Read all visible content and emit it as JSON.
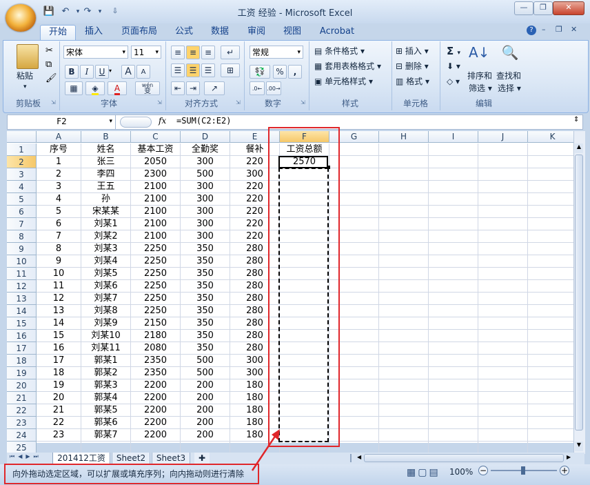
{
  "window": {
    "title": "工资 经验 - Microsoft Excel"
  },
  "ribbon_tabs": [
    "开始",
    "插入",
    "页面布局",
    "公式",
    "数据",
    "审阅",
    "视图",
    "Acrobat"
  ],
  "active_tab": "开始",
  "clipboard": {
    "paste": "粘贴",
    "group": "剪贴板"
  },
  "font": {
    "name": "宋体",
    "size": "11",
    "bold": "B",
    "italic": "I",
    "underline": "U",
    "grow": "A",
    "shrink": "A",
    "wen": "wén",
    "wen_char": "变",
    "group": "字体"
  },
  "alignment": {
    "group": "对齐方式"
  },
  "number": {
    "format": "常规",
    "percent": "%",
    "comma": ",",
    "group": "数字"
  },
  "styles": {
    "conditional": "条件格式",
    "table": "套用表格格式",
    "cell": "单元格样式",
    "group": "样式"
  },
  "cells": {
    "insert": "插入",
    "delete": "删除",
    "format": "格式",
    "group": "单元格"
  },
  "editing": {
    "sigma": "Σ",
    "sort": "排序和",
    "sort2": "筛选",
    "find": "查找和",
    "find2": "选择",
    "group": "编辑"
  },
  "formula_bar": {
    "name_box": "F2",
    "fx": "fx",
    "formula": "=SUM(C2:E2)"
  },
  "columns": [
    "A",
    "B",
    "C",
    "D",
    "E",
    "F",
    "G",
    "H",
    "I",
    "J",
    "K"
  ],
  "row_numbers": [
    "1",
    "2",
    "3",
    "4",
    "5",
    "6",
    "7",
    "8",
    "9",
    "10",
    "11",
    "12",
    "13",
    "14",
    "15",
    "16",
    "17",
    "18",
    "19",
    "20",
    "21",
    "22",
    "23",
    "24",
    "25"
  ],
  "header_row": [
    "序号",
    "姓名",
    "基本工资",
    "全勤奖",
    "餐补",
    "工资总额"
  ],
  "rows": [
    [
      "1",
      "张三",
      "2050",
      "300",
      "220",
      "2570"
    ],
    [
      "2",
      "李四",
      "2300",
      "500",
      "300",
      ""
    ],
    [
      "3",
      "王五",
      "2100",
      "300",
      "220",
      ""
    ],
    [
      "4",
      "孙",
      "2100",
      "300",
      "220",
      ""
    ],
    [
      "5",
      "宋某某",
      "2100",
      "300",
      "220",
      ""
    ],
    [
      "6",
      "刘某1",
      "2100",
      "300",
      "220",
      ""
    ],
    [
      "7",
      "刘某2",
      "2100",
      "300",
      "220",
      ""
    ],
    [
      "8",
      "刘某3",
      "2250",
      "350",
      "280",
      ""
    ],
    [
      "9",
      "刘某4",
      "2250",
      "350",
      "280",
      ""
    ],
    [
      "10",
      "刘某5",
      "2250",
      "350",
      "280",
      ""
    ],
    [
      "11",
      "刘某6",
      "2250",
      "350",
      "280",
      ""
    ],
    [
      "12",
      "刘某7",
      "2250",
      "350",
      "280",
      ""
    ],
    [
      "13",
      "刘某8",
      "2250",
      "350",
      "280",
      ""
    ],
    [
      "14",
      "刘某9",
      "2150",
      "350",
      "280",
      ""
    ],
    [
      "15",
      "刘某10",
      "2180",
      "350",
      "280",
      ""
    ],
    [
      "16",
      "刘某11",
      "2080",
      "350",
      "280",
      ""
    ],
    [
      "17",
      "郭某1",
      "2350",
      "500",
      "300",
      ""
    ],
    [
      "18",
      "郭某2",
      "2350",
      "500",
      "300",
      ""
    ],
    [
      "19",
      "郭某3",
      "2200",
      "200",
      "180",
      ""
    ],
    [
      "20",
      "郭某4",
      "2200",
      "200",
      "180",
      ""
    ],
    [
      "21",
      "郭某5",
      "2200",
      "200",
      "180",
      ""
    ],
    [
      "22",
      "郭某6",
      "2200",
      "200",
      "180",
      ""
    ],
    [
      "23",
      "郭某7",
      "2200",
      "200",
      "180",
      ""
    ]
  ],
  "sheet_tabs": [
    "201412工资",
    "Sheet2",
    "Sheet3"
  ],
  "status": {
    "message": "向外拖动选定区域，可以扩展或填充序列；向内拖动则进行清除",
    "zoom": "100%"
  },
  "colors": {
    "annotation": "#e0262a",
    "selection": "#000000"
  }
}
